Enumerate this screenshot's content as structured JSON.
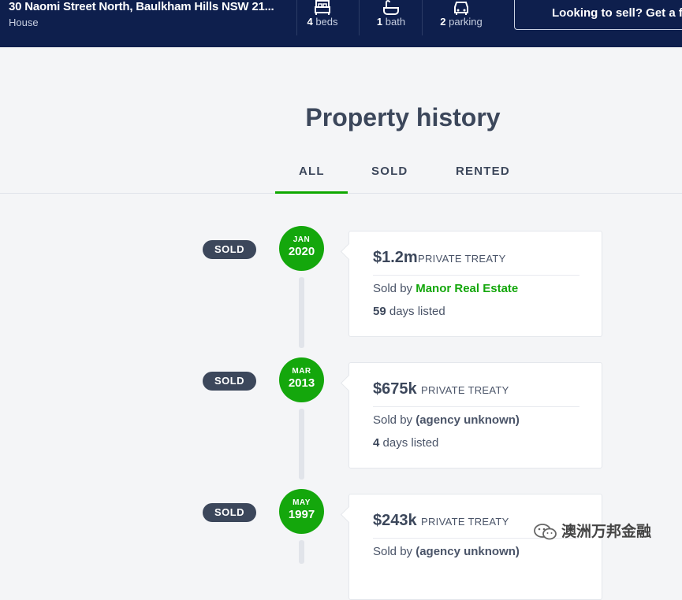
{
  "header": {
    "address": "30 Naomi Street North, Baulkham Hills NSW 21...",
    "property_type": "House",
    "features": [
      {
        "icon": "bed-icon",
        "value": "4",
        "label": "beds"
      },
      {
        "icon": "bath-icon",
        "value": "1",
        "label": "bath"
      },
      {
        "icon": "car-icon",
        "value": "2",
        "label": "parking"
      }
    ],
    "sell_button": "Looking to sell? Get a free"
  },
  "history": {
    "title": "Property history",
    "tabs": [
      "ALL",
      "SOLD",
      "RENTED"
    ],
    "active_tab": "ALL",
    "entries": [
      {
        "status": "SOLD",
        "month": "JAN",
        "year": "2020",
        "price": "$1.2m",
        "method": "PRIVATE TREATY",
        "sold_by_label": "Sold by",
        "agent": "Manor Real Estate",
        "days_value": "59",
        "days_label": "days listed"
      },
      {
        "status": "SOLD",
        "month": "MAR",
        "year": "2013",
        "price": "$675k",
        "method": "PRIVATE TREATY",
        "sold_by_label": "Sold by",
        "agent": "(agency unknown)",
        "days_value": "4",
        "days_label": "days listed"
      },
      {
        "status": "SOLD",
        "month": "MAY",
        "year": "1997",
        "price": "$243k",
        "method": "PRIVATE TREATY",
        "sold_by_label": "Sold by",
        "agent": "(agency unknown)"
      }
    ]
  },
  "watermark": "澳洲万邦金融",
  "colors": {
    "header_bg": "#0e1f4d",
    "accent_green": "#14a70c",
    "pill_dark": "#3c475b",
    "page_bg": "#f4f5f7"
  }
}
